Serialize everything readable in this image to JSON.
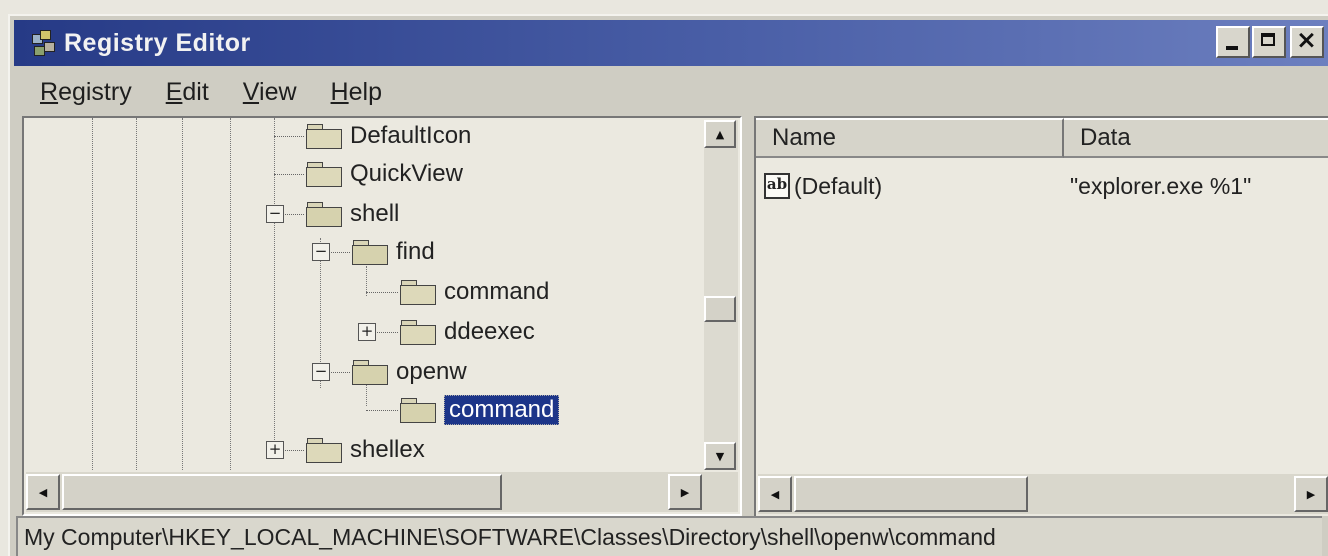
{
  "window": {
    "title": "Registry Editor",
    "title_colors": [
      "#263a86",
      "#6c7fbf"
    ],
    "controls": [
      "minimize-icon",
      "maximize-icon",
      "close-icon"
    ]
  },
  "menu": {
    "items": [
      {
        "first": "R",
        "rest": "egistry"
      },
      {
        "first": "E",
        "rest": "dit"
      },
      {
        "first": "V",
        "rest": "iew"
      },
      {
        "first": "H",
        "rest": "elp"
      }
    ]
  },
  "tree": {
    "nodes": [
      {
        "label": "DefaultIcon",
        "expander": ""
      },
      {
        "label": "QuickView",
        "expander": ""
      },
      {
        "label": "shell",
        "expander": "−"
      },
      {
        "label": "find",
        "expander": "−"
      },
      {
        "label": "command",
        "expander": ""
      },
      {
        "label": "ddeexec",
        "expander": "+"
      },
      {
        "label": "openw",
        "expander": "−"
      },
      {
        "label": "command",
        "expander": "",
        "selected": true
      },
      {
        "label": "shellex",
        "expander": "+"
      }
    ],
    "selection_color": "#1c3589"
  },
  "list": {
    "columns": [
      "Name",
      "Data"
    ],
    "rows": [
      {
        "icon": "ab",
        "name": "(Default)",
        "data": "\"explorer.exe %1\""
      }
    ]
  },
  "status": {
    "path": "My Computer\\HKEY_LOCAL_MACHINE\\SOFTWARE\\Classes\\Directory\\shell\\openw\\command"
  }
}
